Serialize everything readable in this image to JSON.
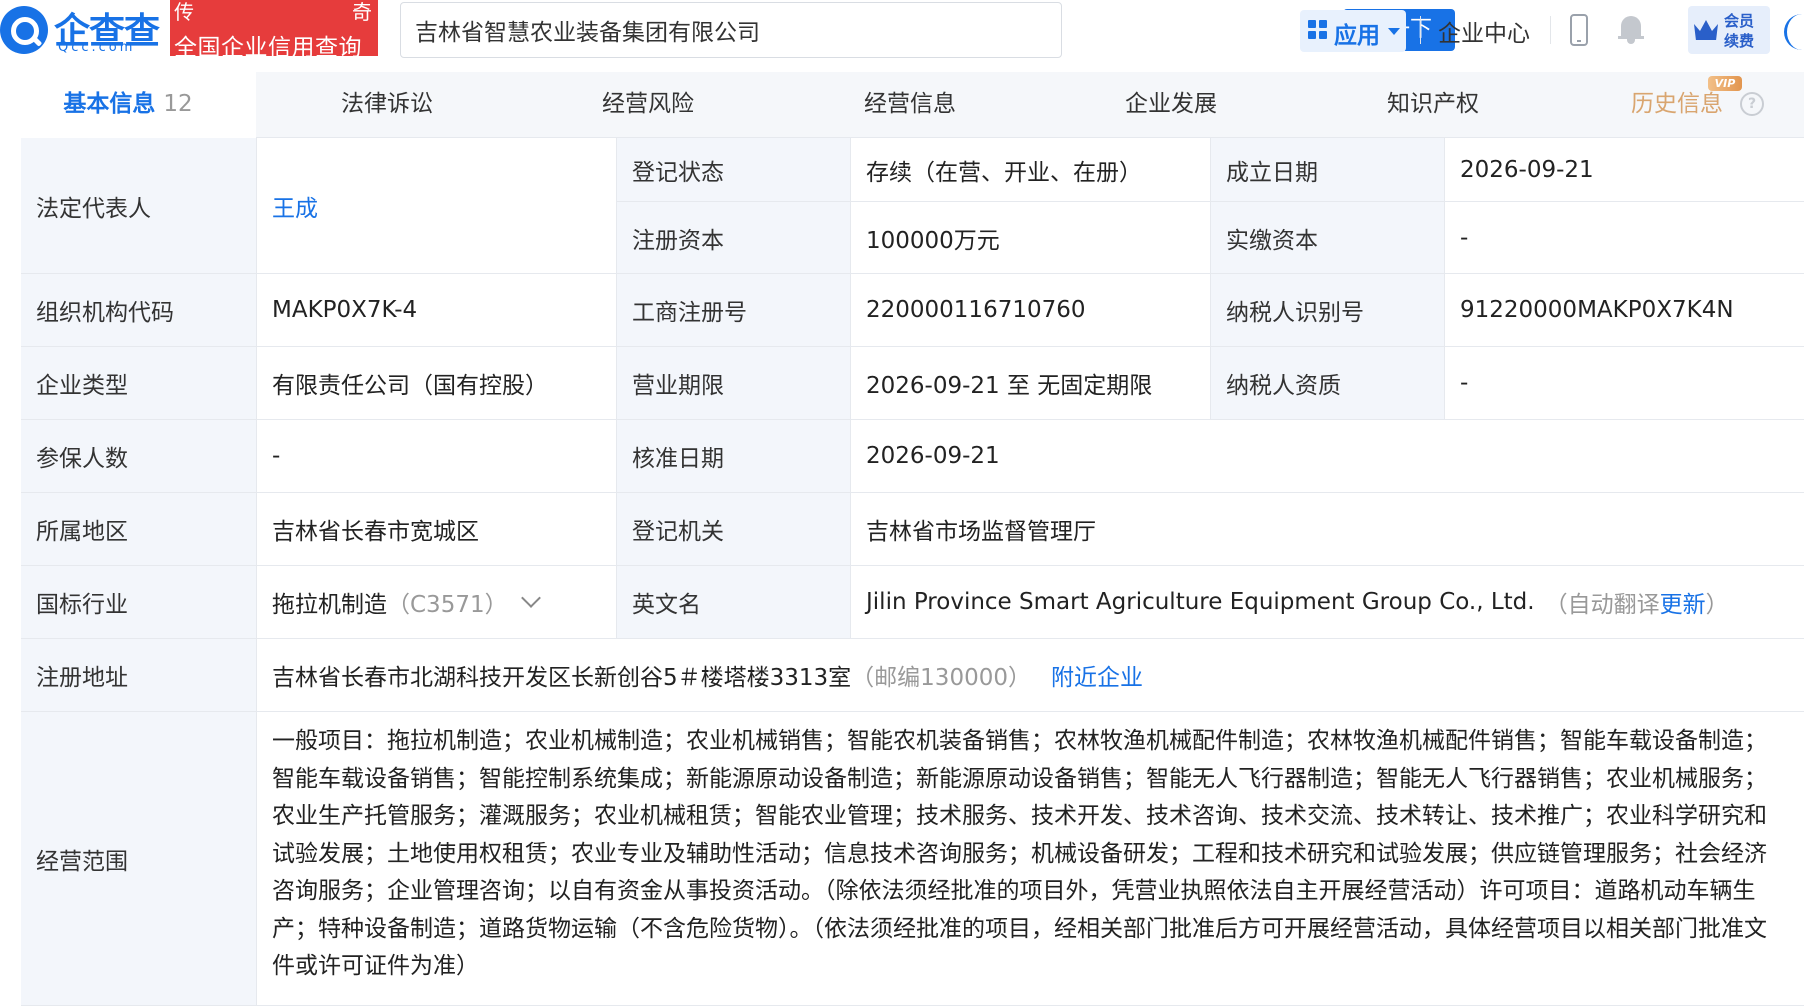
{
  "header": {
    "logo_name": "企查查",
    "logo_url": "Qcc.com",
    "banner_char_left": "传",
    "banner_char_right": "奇",
    "banner_text": "全国企业信用查询",
    "search_value": "吉林省智慧农业装备集团有限公司",
    "search_button": "查一下",
    "apps_label": "应用",
    "enterprise_center": "企业中心",
    "vip_line1": "会员",
    "vip_line2": "续费",
    "colors": {
      "brand": "#1872e6",
      "banner": "#e63c3c",
      "vip": "#2a5fc9",
      "history": "#d9a56f"
    }
  },
  "tabs": [
    {
      "label": "基本信息",
      "count": "12",
      "active": true
    },
    {
      "label": "法律诉讼"
    },
    {
      "label": "经营风险"
    },
    {
      "label": "经营信息"
    },
    {
      "label": "企业发展"
    },
    {
      "label": "知识产权"
    },
    {
      "label": "历史信息",
      "badge": "VIP"
    }
  ],
  "info": {
    "legal_rep_label": "法定代表人",
    "legal_rep_value": "王成",
    "reg_status_label": "登记状态",
    "reg_status_value": "存续（在营、开业、在册）",
    "est_date_label": "成立日期",
    "est_date_value": "2026-09-21",
    "reg_capital_label": "注册资本",
    "reg_capital_value": "100000万元",
    "paid_capital_label": "实缴资本",
    "paid_capital_value": "-",
    "org_code_label": "组织机构代码",
    "org_code_value": "MAKP0X7K-4",
    "biz_reg_no_label": "工商注册号",
    "biz_reg_no_value": "220000116710760",
    "taxpayer_id_label": "纳税人识别号",
    "taxpayer_id_value": "91220000MAKP0X7K4N",
    "ent_type_label": "企业类型",
    "ent_type_value": "有限责任公司（国有控股）",
    "biz_term_label": "营业期限",
    "biz_term_value": "2026-09-21 至 无固定期限",
    "taxpayer_qual_label": "纳税人资质",
    "taxpayer_qual_value": "-",
    "insured_label": "参保人数",
    "insured_value": "-",
    "approval_date_label": "核准日期",
    "approval_date_value": "2026-09-21",
    "region_label": "所属地区",
    "region_value": "吉林省长春市宽城区",
    "authority_label": "登记机关",
    "authority_value": "吉林省市场监督管理厅",
    "industry_label": "国标行业",
    "industry_value": "拖拉机制造",
    "industry_code": "（C3571）",
    "english_name_label": "英文名",
    "english_name_value": "Jilin Province Smart Agriculture Equipment Group Co., Ltd.",
    "english_note_prefix": "（自动翻译",
    "english_note_link": "更新",
    "english_note_suffix": "）",
    "address_label": "注册地址",
    "address_value": "吉林省长春市北湖科技开发区长新创谷5＃楼塔楼3313室",
    "address_postcode": "（邮编130000）",
    "address_nearby_link": "附近企业",
    "scope_label": "经营范围",
    "scope_value": "一般项目：拖拉机制造；农业机械制造；农业机械销售；智能农机装备销售；农林牧渔机械配件制造；农林牧渔机械配件销售；智能车载设备制造；智能车载设备销售；智能控制系统集成；新能源原动设备制造；新能源原动设备销售；智能无人飞行器制造；智能无人飞行器销售；农业机械服务；农业生产托管服务；灌溉服务；农业机械租赁；智能农业管理；技术服务、技术开发、技术咨询、技术交流、技术转让、技术推广；农业科学研究和试验发展；土地使用权租赁；农业专业及辅助性活动；信息技术咨询服务；机械设备研发；工程和技术研究和试验发展；供应链管理服务；社会经济咨询服务；企业管理咨询；以自有资金从事投资活动。（除依法须经批准的项目外，凭营业执照依法自主开展经营活动）许可项目：道路机动车辆生产；特种设备制造；道路货物运输（不含危险货物）。（依法须经批准的项目，经相关部门批准后方可开展经营活动，具体经营项目以相关部门批准文件或许可证件为准）"
  }
}
